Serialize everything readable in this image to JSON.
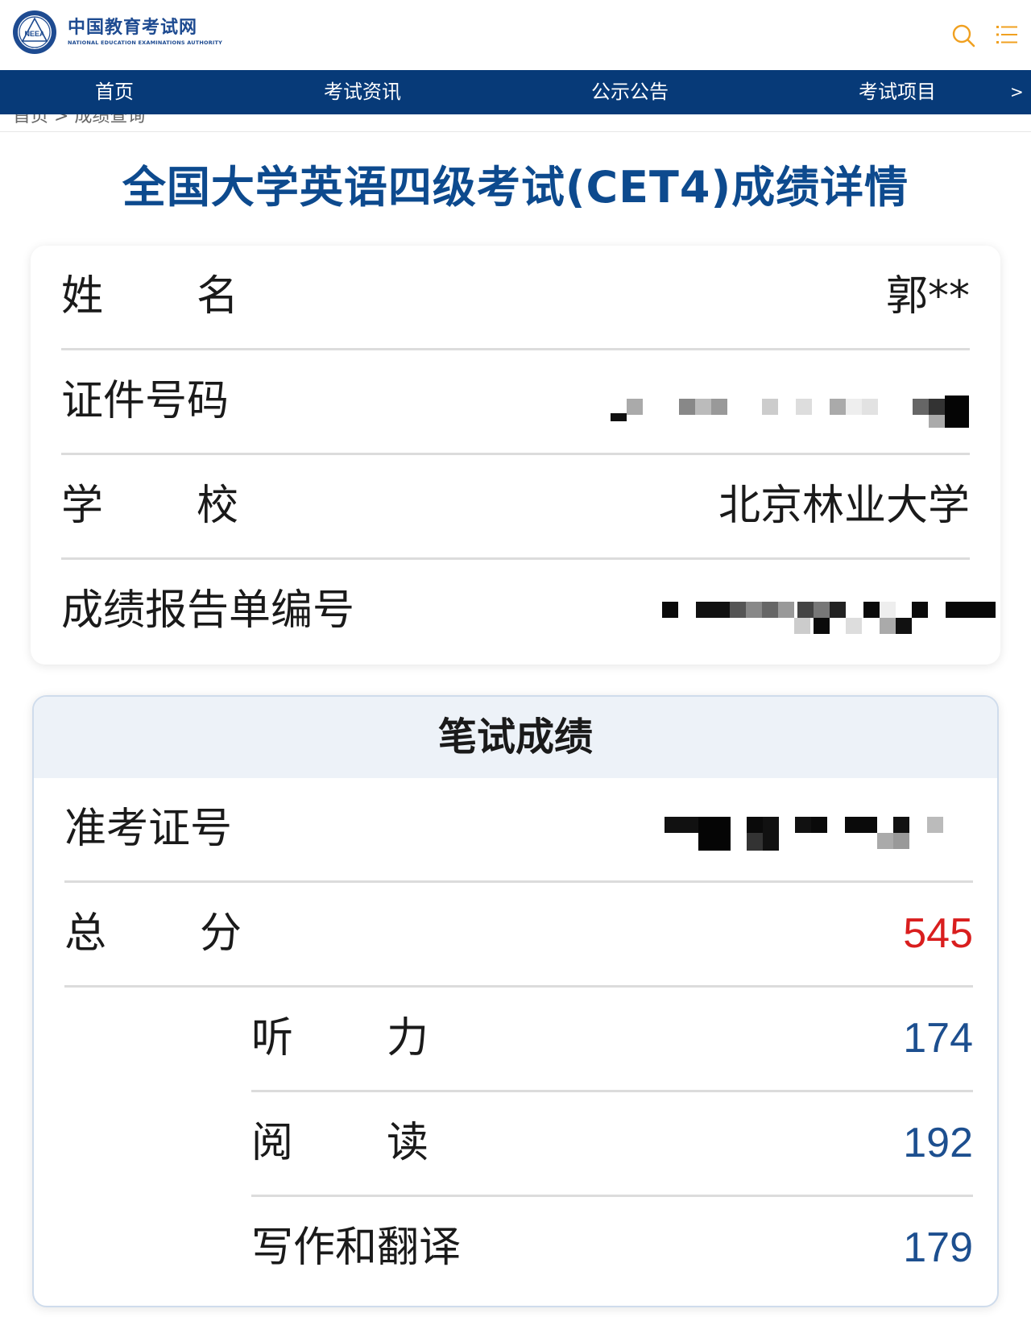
{
  "header": {
    "logo_cn": "中国教育考试网",
    "logo_en": "NATIONAL EDUCATION EXAMINATIONS AUTHORITY",
    "logo_seal": "NEEA",
    "search_icon": "search-icon",
    "menu_icon": "menu-icon",
    "accent_color": "#f0a020"
  },
  "nav": {
    "items": [
      "首页",
      "考试资讯",
      "公示公告",
      "考试项目"
    ],
    "more": ">",
    "background": "#073a78"
  },
  "breadcrumb": "首页 > 成绩查询",
  "title": "全国大学英语四级考试(CET4)成绩详情",
  "info": {
    "name_label": "姓名",
    "name_value": "郭**",
    "id_label": "证件号码",
    "school_label": "学校",
    "school_value": "北京林业大学",
    "report_label": "成绩报告单编号"
  },
  "written": {
    "heading": "笔试成绩",
    "ticket_label": "准考证号",
    "total_label": "总分",
    "total_value": "545",
    "listening_label": "听力",
    "listening_value": "174",
    "reading_label": "阅读",
    "reading_value": "192",
    "writing_label": "写作和翻译",
    "writing_value": "179",
    "total_color": "#d91e1e",
    "sub_color": "#1d4f8f"
  }
}
